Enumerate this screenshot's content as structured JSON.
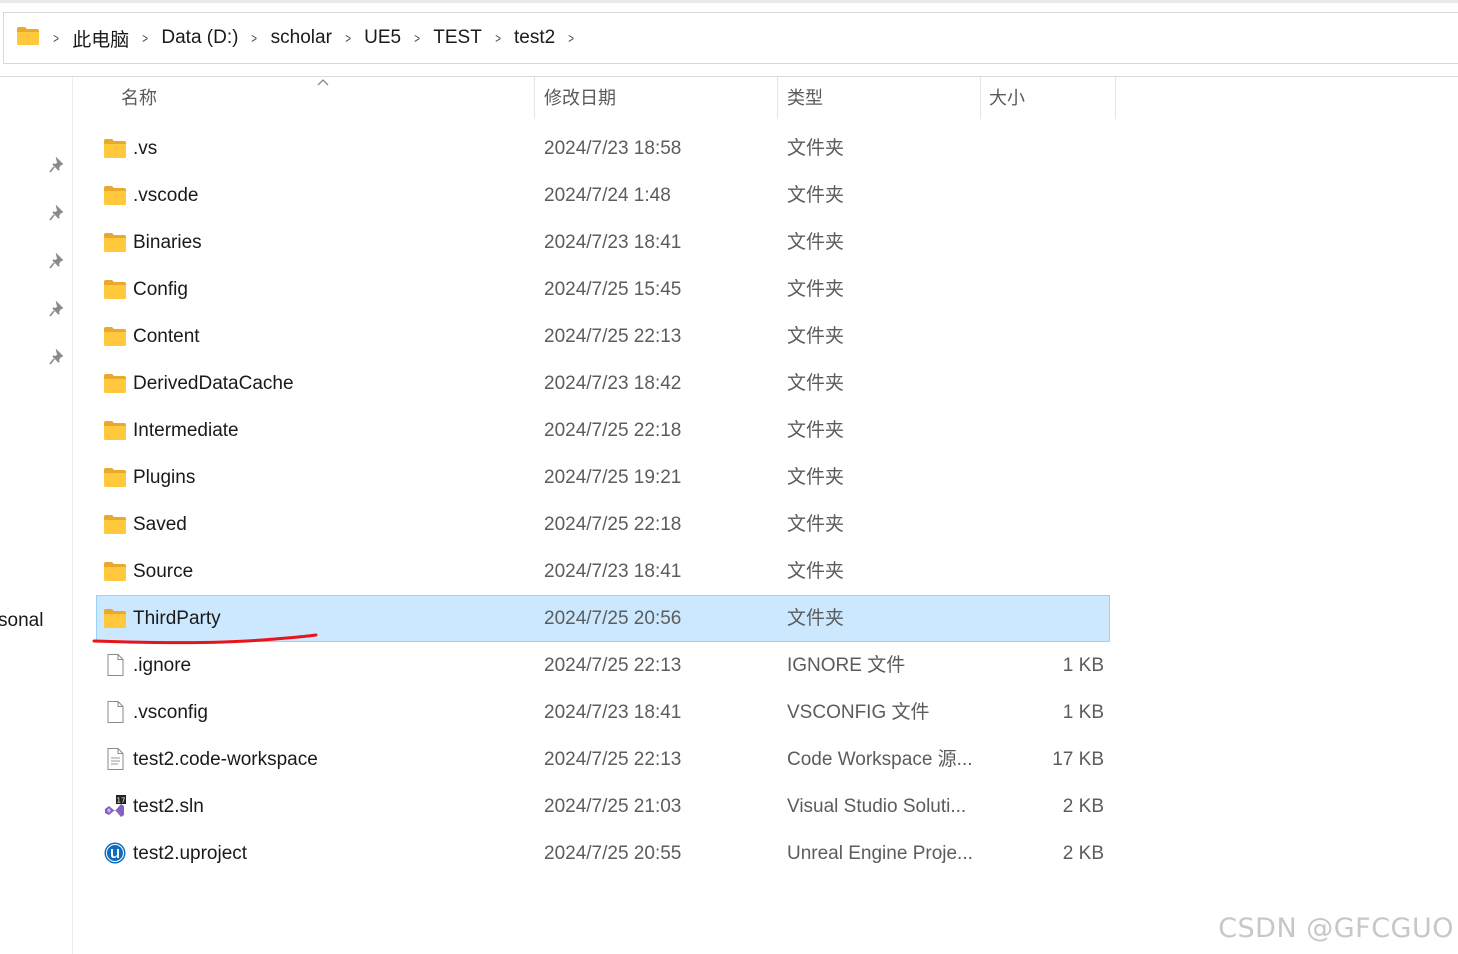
{
  "breadcrumb": [
    "此电脑",
    "Data (D:)",
    "scholar",
    "UE5",
    "TEST",
    "test2"
  ],
  "sidebar_partial_label": "sonal",
  "columns": {
    "name": "名称",
    "date": "修改日期",
    "type": "类型",
    "size": "大小"
  },
  "files": [
    {
      "name": ".vs",
      "date": "2024/7/23 18:58",
      "type": "文件夹",
      "size": "",
      "icon": "folder-icon"
    },
    {
      "name": ".vscode",
      "date": "2024/7/24 1:48",
      "type": "文件夹",
      "size": "",
      "icon": "folder-icon"
    },
    {
      "name": "Binaries",
      "date": "2024/7/23 18:41",
      "type": "文件夹",
      "size": "",
      "icon": "folder-icon"
    },
    {
      "name": "Config",
      "date": "2024/7/25 15:45",
      "type": "文件夹",
      "size": "",
      "icon": "folder-icon"
    },
    {
      "name": "Content",
      "date": "2024/7/25 22:13",
      "type": "文件夹",
      "size": "",
      "icon": "folder-icon"
    },
    {
      "name": "DerivedDataCache",
      "date": "2024/7/23 18:42",
      "type": "文件夹",
      "size": "",
      "icon": "folder-icon"
    },
    {
      "name": "Intermediate",
      "date": "2024/7/25 22:18",
      "type": "文件夹",
      "size": "",
      "icon": "folder-icon"
    },
    {
      "name": "Plugins",
      "date": "2024/7/25 19:21",
      "type": "文件夹",
      "size": "",
      "icon": "folder-icon"
    },
    {
      "name": "Saved",
      "date": "2024/7/25 22:18",
      "type": "文件夹",
      "size": "",
      "icon": "folder-icon"
    },
    {
      "name": "Source",
      "date": "2024/7/23 18:41",
      "type": "文件夹",
      "size": "",
      "icon": "folder-icon"
    },
    {
      "name": "ThirdParty",
      "date": "2024/7/25 20:56",
      "type": "文件夹",
      "size": "",
      "icon": "folder-icon",
      "selected": true
    },
    {
      "name": ".ignore",
      "date": "2024/7/25 22:13",
      "type": "IGNORE 文件",
      "size": "1 KB",
      "icon": "file-icon"
    },
    {
      "name": ".vsconfig",
      "date": "2024/7/23 18:41",
      "type": "VSCONFIG 文件",
      "size": "1 KB",
      "icon": "file-icon"
    },
    {
      "name": "test2.code-workspace",
      "date": "2024/7/25 22:13",
      "type": "Code Workspace 源...",
      "size": "17 KB",
      "icon": "text-file-icon"
    },
    {
      "name": "test2.sln",
      "date": "2024/7/25 21:03",
      "type": "Visual Studio Soluti...",
      "size": "2 KB",
      "icon": "visual-studio-solution-icon"
    },
    {
      "name": "test2.uproject",
      "date": "2024/7/25 20:55",
      "type": "Unreal Engine Proje...",
      "size": "2 KB",
      "icon": "unreal-engine-icon"
    }
  ],
  "watermark": "CSDN @GFCGUO",
  "colors": {
    "selection_bg": "#cce8ff",
    "selection_border": "#99d1ff",
    "annotation_red": "#e8141b",
    "folder_yellow": "#ffc83d"
  }
}
